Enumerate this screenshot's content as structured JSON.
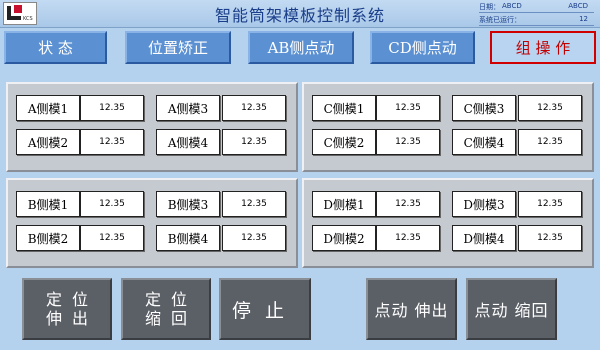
{
  "header": {
    "logo_text": "KCS",
    "title": "智能筒架模板控制系统",
    "date_label": "日期：",
    "date_value1": "ABCD",
    "date_value2": "ABCD",
    "runtime_label": "系统已运行：",
    "runtime_value": "12"
  },
  "tabs": [
    {
      "label": "状 态"
    },
    {
      "label": "位置矫正"
    },
    {
      "label": "AB侧点动"
    },
    {
      "label": "CD侧点动"
    },
    {
      "label": "组 操 作"
    }
  ],
  "active_tab_index": 4,
  "panels": {
    "A": [
      {
        "label": "A侧模1",
        "value": "12.35"
      },
      {
        "label": "A侧模3",
        "value": "12.35"
      },
      {
        "label": "A侧模2",
        "value": "12.35"
      },
      {
        "label": "A侧模4",
        "value": "12.35"
      }
    ],
    "C": [
      {
        "label": "C侧模1",
        "value": "12.35"
      },
      {
        "label": "C侧模3",
        "value": "12.35"
      },
      {
        "label": "C侧模2",
        "value": "12.35"
      },
      {
        "label": "C侧模4",
        "value": "12.35"
      }
    ],
    "B": [
      {
        "label": "B侧模1",
        "value": "12.35"
      },
      {
        "label": "B侧模3",
        "value": "12.35"
      },
      {
        "label": "B侧模2",
        "value": "12.35"
      },
      {
        "label": "B侧模4",
        "value": "12.35"
      }
    ],
    "D": [
      {
        "label": "D侧模1",
        "value": "12.35"
      },
      {
        "label": "D侧模3",
        "value": "12.35"
      },
      {
        "label": "D侧模2",
        "value": "12.35"
      },
      {
        "label": "D侧模4",
        "value": "12.35"
      }
    ]
  },
  "buttons": {
    "position_extend_l1": "定位",
    "position_extend_l2": "伸出",
    "position_retract_l1": "定位",
    "position_retract_l2": "缩回",
    "stop": "停止",
    "jog_extend": "点动 伸出",
    "jog_retract": "点动 缩回"
  },
  "colors": {
    "background": "#b4d1ee",
    "tab": "#5b90d2",
    "active_tab_border": "#d00000",
    "panel": "#c5cad1",
    "action_button": "#5b5f66"
  }
}
